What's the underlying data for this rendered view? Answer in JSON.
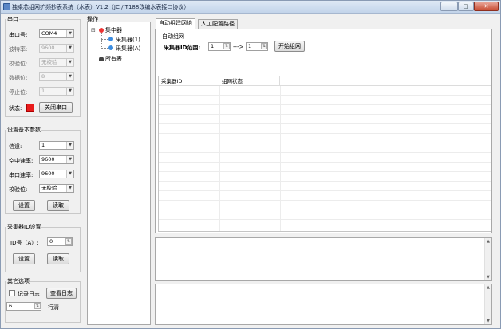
{
  "window": {
    "title": "独桌芯组网扩频抄表系统（水表）V1.2（JC / T188改编水表接口协议）",
    "minimize_glyph": "─",
    "maximize_glyph": "□",
    "close_glyph": "✕"
  },
  "serial": {
    "group_label": "串口",
    "port_label": "串口号:",
    "port_value": "COM4",
    "baud_label": "波特率:",
    "baud_value": "9600",
    "parity_label": "校验位:",
    "parity_value": "无校验",
    "databits_label": "数据位:",
    "databits_value": "8",
    "stopbits_label": "停止位:",
    "stopbits_value": "1",
    "status_label": "状态:",
    "close_button": "关闭串口",
    "status_color": "#e81b1b"
  },
  "device_params": {
    "group_label": "设置基本参数",
    "channel_label": "信道:",
    "channel_value": "1",
    "air_rate_label": "空中速率:",
    "air_rate_value": "9600",
    "port_rate_label": "串口速率:",
    "port_rate_value": "9600",
    "parity_label": "校验位:",
    "parity_value": "无校验",
    "set_button": "设置",
    "read_button": "读取"
  },
  "collector_id": {
    "group_label": "采集器ID设置",
    "id_label": "ID号（A）:",
    "id_value": "0",
    "set_button": "设置",
    "read_button": "读取"
  },
  "other": {
    "group_label": "其它选项",
    "log_checkbox_label": "记录日志",
    "view_log_button": "查看日志",
    "rows_value": "6",
    "rows_label": "行清"
  },
  "tree": {
    "header": "操作",
    "root": "集中器",
    "children": [
      "采集器(1)",
      "采集器(A)"
    ],
    "all_meters": "所有表",
    "expand_glyph": "⊟"
  },
  "tabs": {
    "tab1": "自动组建网络",
    "tab2": "人工配置路径"
  },
  "auto_network": {
    "section_label": "自动组网",
    "range_label": "采集器ID范围:",
    "range_start": "1",
    "range_sep": "--->",
    "range_end": "1",
    "start_button": "开始组网"
  },
  "grid": {
    "columns": [
      "采集器ID",
      "组网状态"
    ]
  }
}
